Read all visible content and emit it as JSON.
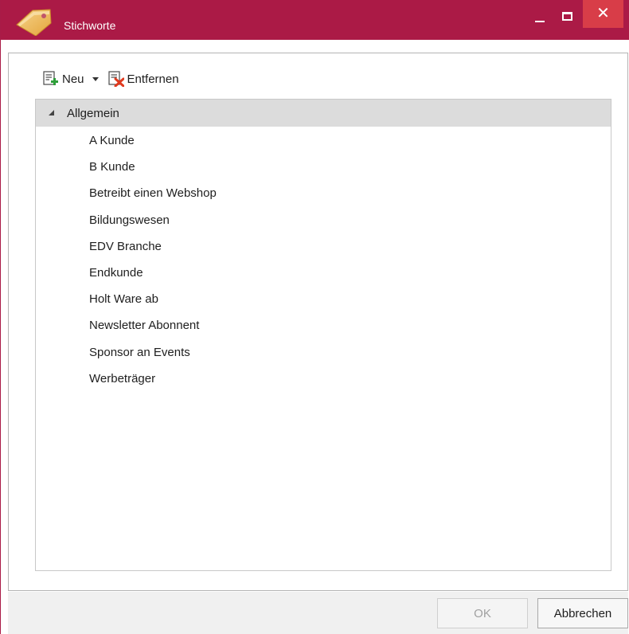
{
  "window": {
    "title": "Stichworte",
    "accent_color": "#ab1a46",
    "close_color": "#d83d48",
    "icons": {
      "app": "tag-icon",
      "minimize": "minimize-icon",
      "maximize": "maximize-icon",
      "close": "close-icon"
    }
  },
  "toolbar": {
    "new_label": "Neu",
    "remove_label": "Entfernen",
    "icons": {
      "new": "add-keyword-icon",
      "dropdown": "chevron-down-icon",
      "remove": "remove-keyword-icon"
    }
  },
  "tree": {
    "root": {
      "label": "Allgemein",
      "expanded": true
    },
    "items": [
      "A Kunde",
      "B Kunde",
      "Betreibt einen Webshop",
      "Bildungswesen",
      "EDV Branche",
      "Endkunde",
      "Holt Ware ab",
      "Newsletter Abonnent",
      "Sponsor an Events",
      "Werbeträger"
    ]
  },
  "buttons": {
    "ok_label": "OK",
    "ok_enabled": false,
    "cancel_label": "Abbrechen"
  }
}
